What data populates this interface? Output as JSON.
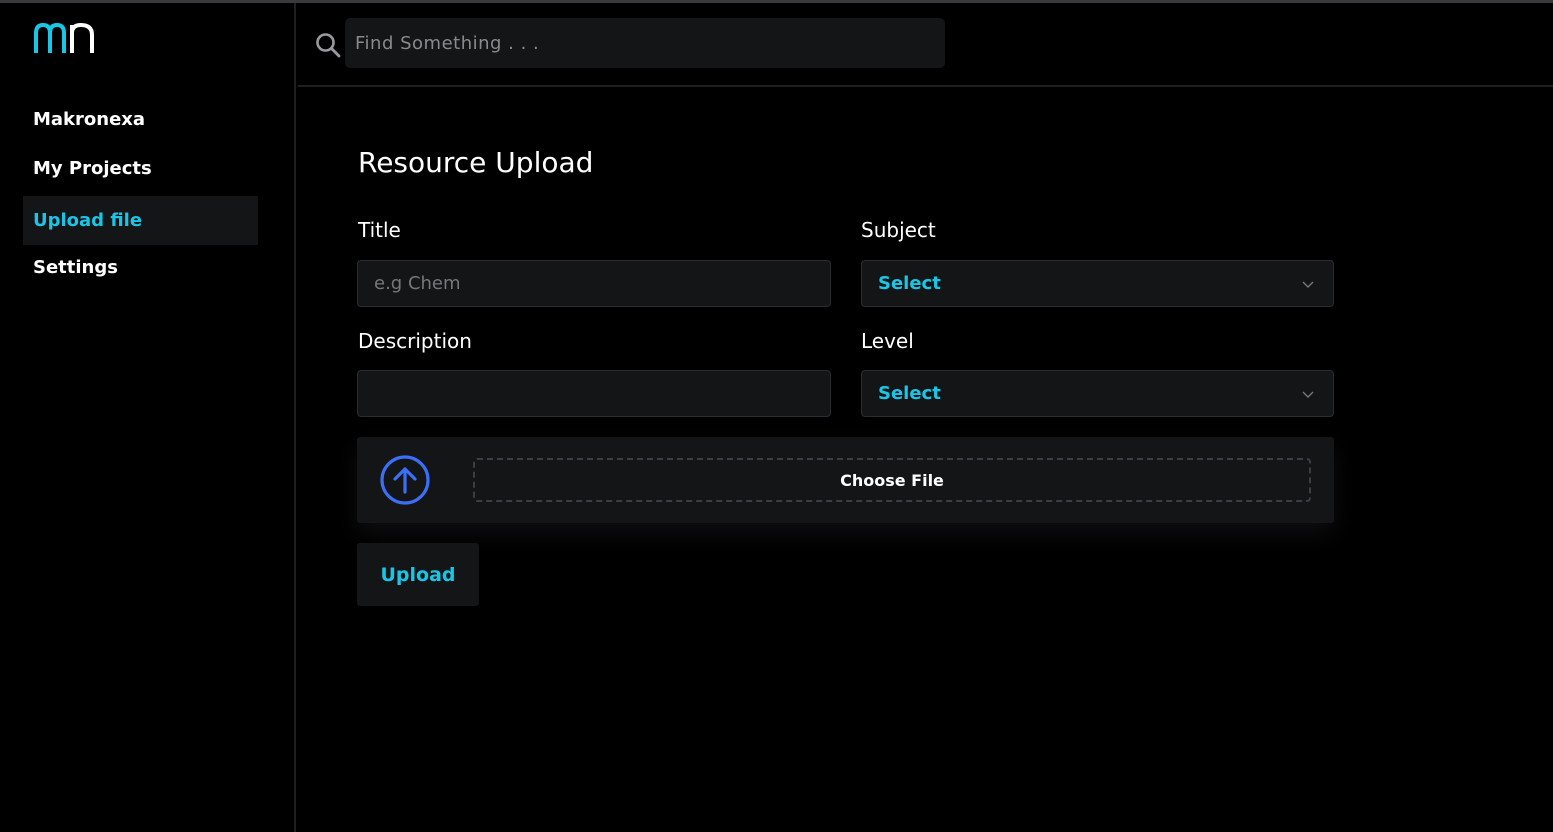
{
  "colors": {
    "accent": "#19c6e6",
    "upload_icon": "#3b6ff5",
    "panel": "#141517",
    "background": "#000000"
  },
  "sidebar": {
    "logo_icon": "mn-logo-icon",
    "items": [
      {
        "label": "Makronexa",
        "active": false
      },
      {
        "label": "My Projects",
        "active": false
      },
      {
        "label": "Upload file",
        "active": true
      },
      {
        "label": "Settings",
        "active": false
      }
    ]
  },
  "search": {
    "icon": "search-icon",
    "placeholder": "Find Something . . .",
    "value": ""
  },
  "form": {
    "title": "Resource Upload",
    "title_field": {
      "label": "Title",
      "placeholder": "e.g Chem",
      "value": ""
    },
    "subject_field": {
      "label": "Subject",
      "selected": "Select"
    },
    "description_field": {
      "label": "Description",
      "placeholder": "",
      "value": ""
    },
    "level_field": {
      "label": "Level",
      "selected": "Select"
    },
    "file": {
      "icon": "arrow-up-circle-icon",
      "choose_label": "Choose File"
    },
    "upload_label": "Upload"
  }
}
